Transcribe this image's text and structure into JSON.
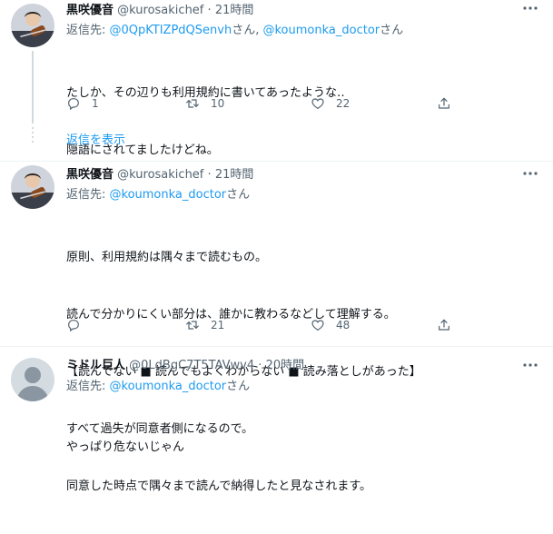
{
  "tweets": [
    {
      "name": "黒咲優音",
      "handle": "@kurosakichef",
      "sep": "·",
      "time": "21時間",
      "reply_prefix": "返信先: ",
      "reply_mention_1": "@0QpKTIZPdQSenvh",
      "reply_sep": "さん, ",
      "reply_mention_2": "@koumonka_doctor",
      "reply_suffix": "さん",
      "lines": [
        "たしか、その辺りも利用規約に書いてあったような‥",
        "隠語にされてましたけどね。"
      ],
      "replies": "1",
      "retweets": "10",
      "likes": "22"
    },
    {
      "name": "黒咲優音",
      "handle": "@kurosakichef",
      "sep": "·",
      "time": "21時間",
      "reply_prefix": "返信先: ",
      "reply_mention": "@koumonka_doctor",
      "reply_suffix": "さん",
      "lines": [
        "原則、利用規約は隅々まで読むもの。",
        "読んで分かりにくい部分は、誰かに教わるなどして理解する。",
        "【読んでない ■ 読んでもよくわからない ■ 読み落としがあった】",
        "すべて過失が同意者側になるので。",
        "同意した時点で隅々まで読んで納得したと見なされます。"
      ],
      "replies": "",
      "retweets": "21",
      "likes": "48"
    },
    {
      "name": "ミドル巨人",
      "handle": "@0LdBgC7T5TAVwv4",
      "sep": "·",
      "time": "20時間",
      "reply_prefix": "返信先: ",
      "reply_mention": "@koumonka_doctor",
      "reply_suffix": "さん",
      "lines": [
        "やっぱり危ないじゃん"
      ]
    }
  ],
  "show_replies": "返信を表示",
  "icons": {
    "more": "more-icon",
    "reply": "reply-icon",
    "retweet": "retweet-icon",
    "like": "like-icon",
    "share": "share-icon"
  },
  "colors": {
    "link": "#1d9bf0",
    "secondary": "#536471",
    "text": "#0f1419",
    "thread_line": "#cfd9de"
  }
}
